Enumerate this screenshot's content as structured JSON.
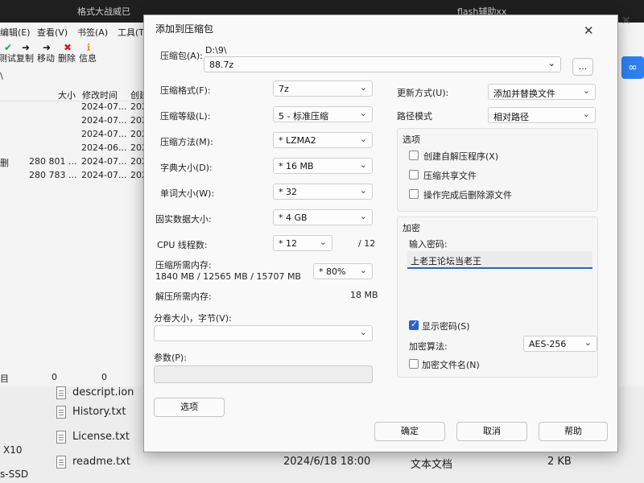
{
  "background": {
    "topbar": {
      "left_text": "格式大战威已",
      "right_text": "flash辅助xx"
    },
    "menu": [
      "编辑(E)",
      "查看(V)",
      "书签(A)",
      "工具(T)"
    ],
    "toolbar": [
      {
        "icon": "check-icon",
        "label": "测试"
      },
      {
        "icon": "copy-arrow-icon",
        "label": "复制"
      },
      {
        "icon": "move-arrow-icon",
        "label": "移动"
      },
      {
        "icon": "delete-x-icon",
        "label": "删除"
      },
      {
        "icon": "info-icon",
        "label": "信息"
      }
    ],
    "path": "\\",
    "columns": {
      "size": "大小",
      "modified": "修改时间",
      "created": "创建"
    },
    "rows": [
      {
        "name": "",
        "size": "",
        "modified": "2024-07...",
        "created": "202"
      },
      {
        "name": "",
        "size": "",
        "modified": "2024-07...",
        "created": "202"
      },
      {
        "name": "",
        "size": "",
        "modified": "2024-07...",
        "created": "202"
      },
      {
        "name": "",
        "size": "",
        "modified": "2024-06...",
        "created": "202"
      },
      {
        "name": "删",
        "size": "280 801 ...",
        "modified": "2024-07...",
        "created": "202"
      },
      {
        "name": "",
        "size": "280 783 ...",
        "modified": "2024-07...",
        "created": "202"
      }
    ],
    "status": {
      "label": "目",
      "v1": "0",
      "v2": "0"
    }
  },
  "explorer": {
    "left_labels": [
      "X10",
      "s-SSD"
    ],
    "files": [
      {
        "name": "descript.ion",
        "date": "",
        "type": "",
        "size": ""
      },
      {
        "name": "History.txt",
        "date": "",
        "type": "",
        "size": ""
      },
      {
        "name": "License.txt",
        "date": "",
        "type": "",
        "size": ""
      },
      {
        "name": "readme.txt",
        "date": "2024/6/18 18:00",
        "type": "文本文档",
        "size": "2 KB"
      }
    ]
  },
  "dialog": {
    "title": "添加到压缩包",
    "archive": {
      "label": "压缩包(A):",
      "dir": "D:\\9\\",
      "value": "88.7z",
      "browse": "..."
    },
    "format": {
      "label": "压缩格式(F):",
      "value": "7z"
    },
    "level": {
      "label": "压缩等级(L):",
      "value": "5 - 标准压缩"
    },
    "method": {
      "label": "压缩方法(M):",
      "value": "* LZMA2"
    },
    "dict": {
      "label": "字典大小(D):",
      "value": "* 16 MB"
    },
    "word": {
      "label": "单词大小(W):",
      "value": "* 32"
    },
    "solid": {
      "label": "固实数据大小:",
      "value": "* 4 GB"
    },
    "threads": {
      "label": "CPU 线程数:",
      "value": "* 12",
      "max": "/ 12"
    },
    "mem_compress": {
      "label": "压缩所需内存:",
      "detail": "1840 MB / 12565 MB / 15707 MB",
      "percent": "* 80%"
    },
    "mem_decompress": {
      "label": "解压所需内存:",
      "value": "18 MB"
    },
    "split": {
      "label": "分卷大小，字节(V):",
      "value": ""
    },
    "params": {
      "label": "参数(P):",
      "value": ""
    },
    "options_btn": "选项",
    "update": {
      "label": "更新方式(U):",
      "value": "添加并替换文件"
    },
    "pathmode": {
      "label": "路径模式",
      "value": "相对路径"
    },
    "options_group": {
      "title": "选项",
      "items": [
        {
          "label": "创建自解压程序(X)",
          "checked": false
        },
        {
          "label": "压缩共享文件",
          "checked": false
        },
        {
          "label": "操作完成后删除源文件",
          "checked": false
        }
      ]
    },
    "encryption": {
      "title": "加密",
      "pwd_label": "输入密码:",
      "pwd_value": "上老王论坛当老王",
      "show_pwd": {
        "label": "显示密码(S)",
        "checked": true
      },
      "method_label": "加密算法:",
      "method_value": "AES-256",
      "encrypt_names": {
        "label": "加密文件名(N)",
        "checked": false
      }
    },
    "buttons": {
      "ok": "确定",
      "cancel": "取消",
      "help": "帮助"
    }
  }
}
